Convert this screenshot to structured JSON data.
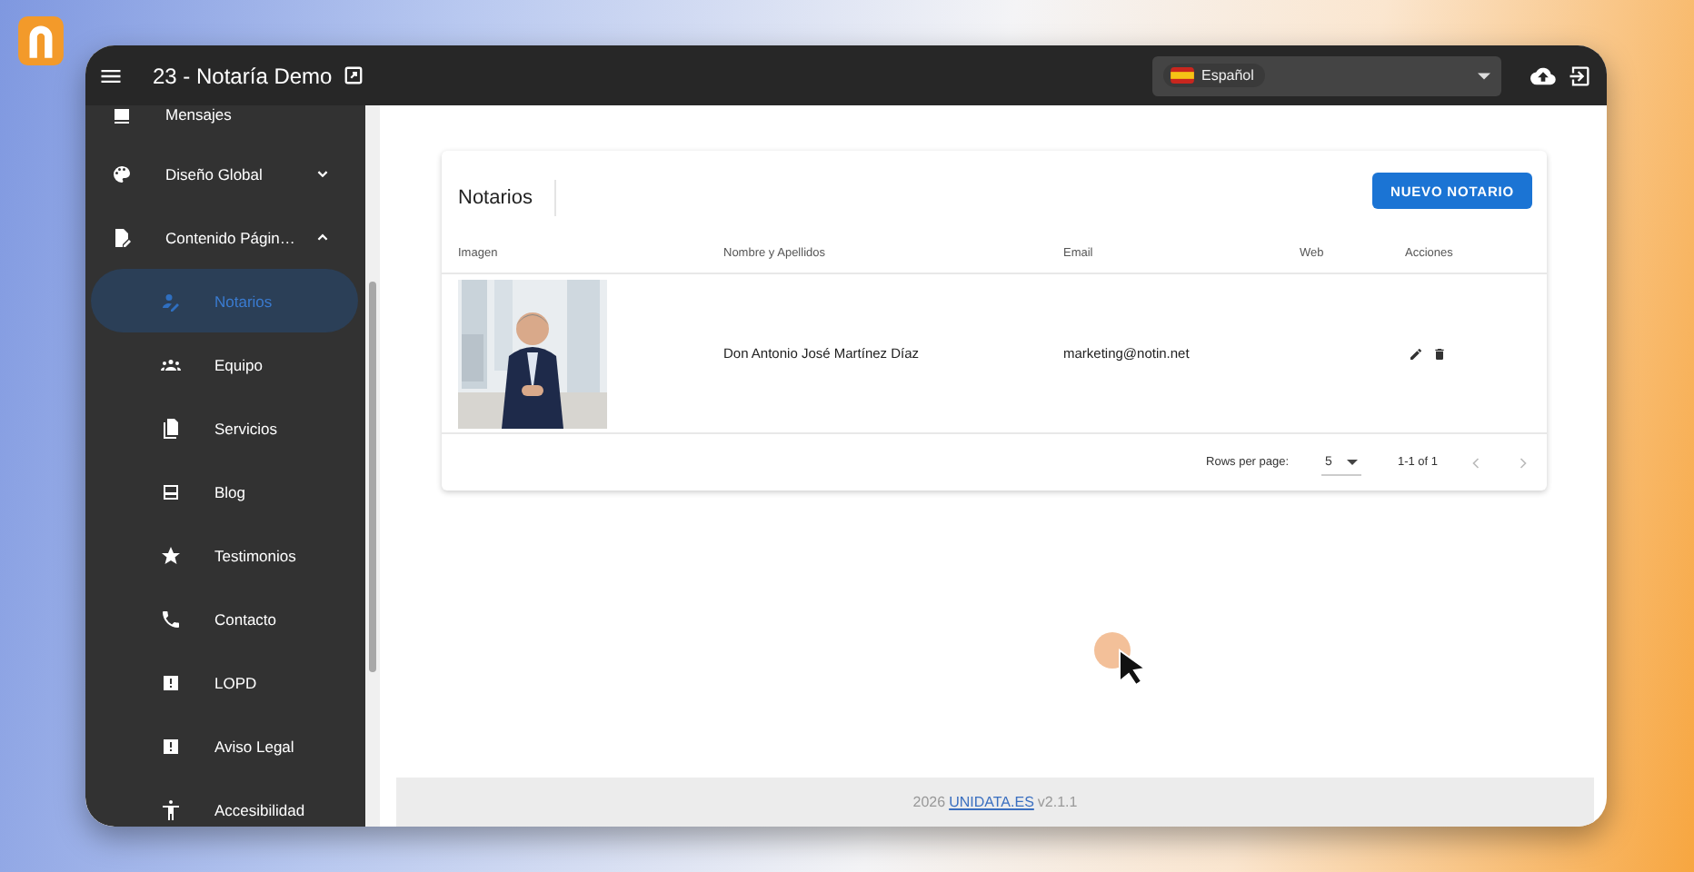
{
  "app": {
    "title": "23 - Notaría Demo"
  },
  "language": {
    "label": "Español"
  },
  "sidebar": {
    "items": [
      {
        "label": "Mensajes",
        "kind": "item",
        "selected": false
      },
      {
        "label": "Diseño Global",
        "kind": "group",
        "expanded": false,
        "selected": false
      },
      {
        "label": "Contenido Págin…",
        "kind": "group",
        "expanded": true,
        "selected": false,
        "children": [
          {
            "label": "Notarios",
            "selected": true
          },
          {
            "label": "Equipo",
            "selected": false
          },
          {
            "label": "Servicios",
            "selected": false
          },
          {
            "label": "Blog",
            "selected": false
          },
          {
            "label": "Testimonios",
            "selected": false
          },
          {
            "label": "Contacto",
            "selected": false
          },
          {
            "label": "LOPD",
            "selected": false
          },
          {
            "label": "Aviso Legal",
            "selected": false
          },
          {
            "label": "Accesibilidad",
            "selected": false
          }
        ]
      }
    ]
  },
  "card": {
    "title": "Notarios",
    "new_button": "NUEVO NOTARIO"
  },
  "table": {
    "columns": [
      "Imagen",
      "Nombre y Apellidos",
      "Email",
      "Web",
      "Acciones"
    ],
    "rows": [
      {
        "name": "Don Antonio José Martínez Díaz",
        "email": "marketing@notin.net"
      }
    ]
  },
  "pagination": {
    "rows_label": "Rows per page:",
    "rows_value": "5",
    "range": "1-1 of 1"
  },
  "footer": {
    "year": "2026",
    "link": "UNIDATA.ES",
    "version": "v2.1.1"
  }
}
